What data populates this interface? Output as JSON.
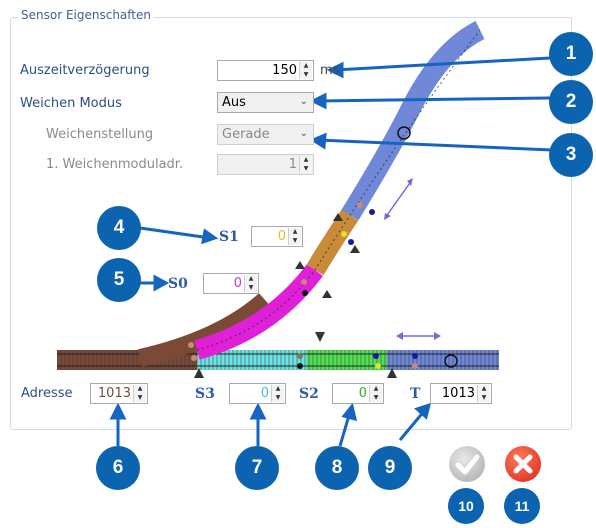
{
  "group": {
    "title": "Sensor Eigenschaften"
  },
  "fields": {
    "auszeit": {
      "label": "Auszeitverzögerung",
      "value": "150",
      "unit": "ms"
    },
    "weichen_modus": {
      "label": "Weichen Modus",
      "value": "Aus"
    },
    "weichenstellung": {
      "label": "Weichenstellung",
      "value": "Gerade"
    },
    "weichenmoduladr": {
      "label": "1. Weichenmoduladr.",
      "value": "1"
    },
    "adresse": {
      "label": "Adresse",
      "value": "1013"
    }
  },
  "sensors": {
    "s1": {
      "label": "S1",
      "value": "0"
    },
    "s0": {
      "label": "S0",
      "value": "0"
    },
    "s3": {
      "label": "S3",
      "value": "0"
    },
    "s2": {
      "label": "S2",
      "value": "0"
    },
    "t": {
      "label": "T",
      "value": "1013"
    }
  },
  "badges": [
    "1",
    "2",
    "3",
    "4",
    "5",
    "6",
    "7",
    "8",
    "9",
    "10",
    "11"
  ],
  "colors": {
    "badge": "#0c63b0",
    "track_brown": "#7a4a36",
    "track_magenta": "#e020d8",
    "track_orange": "#c98a3a",
    "track_blue": "#6f88d8",
    "track_cyan": "#6ee3e3",
    "track_green": "#52e052"
  },
  "icons": [
    "ok-icon",
    "cancel-icon",
    "double-arrow-icon"
  ]
}
